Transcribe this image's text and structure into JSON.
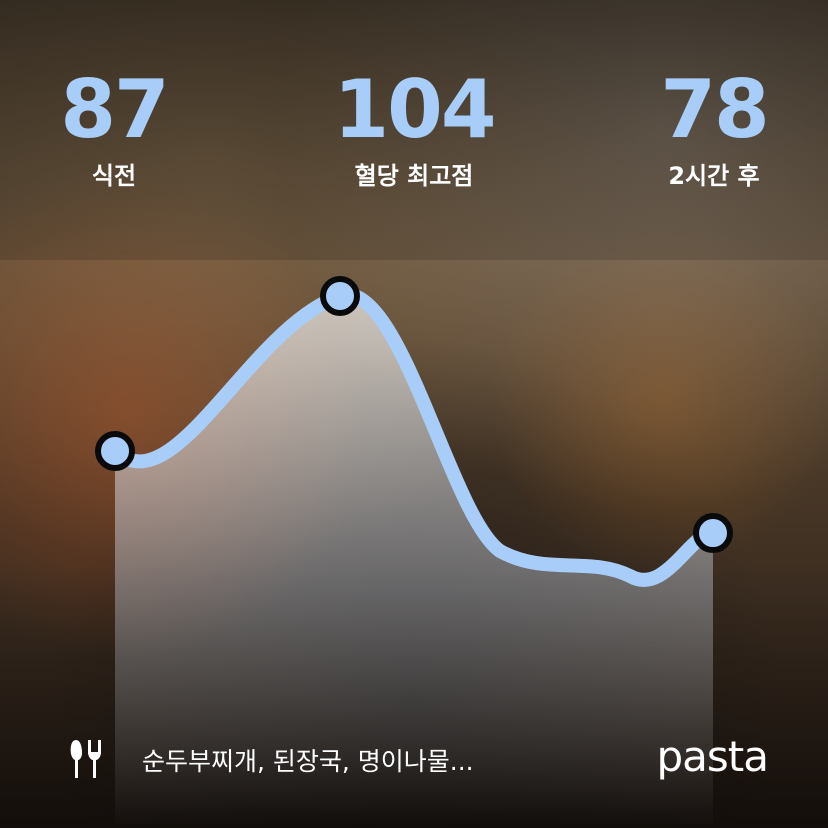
{
  "stats": [
    {
      "value": "87",
      "label": "식전"
    },
    {
      "value": "104",
      "label": "혈당 최고점"
    },
    {
      "value": "78",
      "label": "2시간 후"
    }
  ],
  "meal": {
    "icon": "fork-knife-icon",
    "text": "순두부찌개, 된장국, 명이나물..."
  },
  "brand": "pasta",
  "colors": {
    "accent": "#a8cdf8",
    "text": "#ffffff"
  },
  "chart_data": {
    "type": "line",
    "series": [
      {
        "points": [
          {
            "x": 0,
            "y": 87
          },
          {
            "x": 1,
            "y": 104
          },
          {
            "x": 2,
            "y": 78
          }
        ]
      }
    ]
  }
}
